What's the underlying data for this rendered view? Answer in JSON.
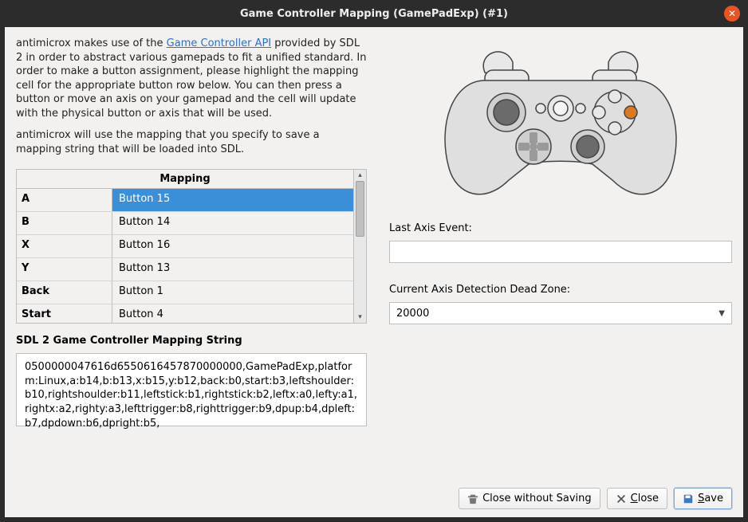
{
  "window": {
    "title": "Game Controller Mapping (GamePadExp) (#1)"
  },
  "intro": {
    "p1_pre": "antimicrox makes use of the ",
    "p1_link": "Game Controller API",
    "p1_post": " provided by SDL 2 in order to abstract various gamepads to fit a unified standard. In order to make a button assignment, please highlight the mapping cell for the appropriate button row below. You can then press a button or move an axis on your gamepad and the cell will update with the physical button or axis that will be used.",
    "p2": "antimicrox will use the mapping that you specify to save a mapping string that will be loaded into SDL."
  },
  "table": {
    "header": "Mapping",
    "rows": [
      {
        "label": "A",
        "mapping": "Button 15",
        "selected": true
      },
      {
        "label": "B",
        "mapping": "Button 14"
      },
      {
        "label": "X",
        "mapping": "Button 16"
      },
      {
        "label": "Y",
        "mapping": "Button 13"
      },
      {
        "label": "Back",
        "mapping": "Button 1"
      },
      {
        "label": "Start",
        "mapping": "Button 4"
      }
    ]
  },
  "mapping_string": {
    "label": "SDL 2 Game Controller Mapping String",
    "value": "0500000047616d6550616457870000000,GamePadExp,platform:Linux,a:b14,b:b13,x:b15,y:b12,back:b0,start:b3,leftshoulder:b10,rightshoulder:b11,leftstick:b1,rightstick:b2,leftx:a0,lefty:a1,rightx:a2,righty:a3,lefttrigger:b8,righttrigger:b9,dpup:b4,dpleft:b7,dpdown:b6,dpright:b5,"
  },
  "right": {
    "last_axis_label": "Last Axis Event:",
    "last_axis_value": "",
    "deadzone_label": "Current Axis Detection Dead Zone:",
    "deadzone_value": "20000"
  },
  "buttons": {
    "close_no_save": "Close without Saving",
    "close_pre": "",
    "close_u": "C",
    "close_post": "lose",
    "save_pre": "",
    "save_u": "S",
    "save_post": "ave"
  }
}
